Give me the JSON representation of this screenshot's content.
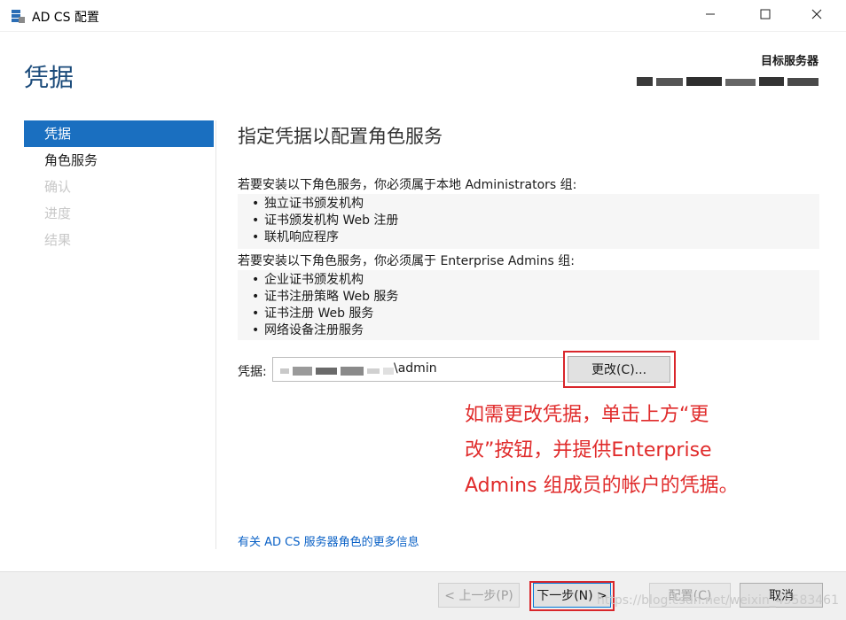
{
  "window": {
    "title": "AD CS 配置",
    "icon": "server-icon"
  },
  "header": {
    "page_title": "凭据",
    "target_label": "目标服务器"
  },
  "sidebar": {
    "items": [
      {
        "label": "凭据",
        "state": "active"
      },
      {
        "label": "角色服务",
        "state": "enabled"
      },
      {
        "label": "确认",
        "state": "disabled"
      },
      {
        "label": "进度",
        "state": "disabled"
      },
      {
        "label": "结果",
        "state": "disabled"
      }
    ]
  },
  "main": {
    "heading": "指定凭据以配置角色服务",
    "section1": {
      "intro": "若要安装以下角色服务，你必须属于本地 Administrators 组:",
      "items": [
        "独立证书颁发机构",
        "证书颁发机构 Web 注册",
        "联机响应程序"
      ]
    },
    "section2": {
      "intro": "若要安装以下角色服务，你必须属于 Enterprise Admins 组:",
      "items": [
        "企业证书颁发机构",
        "证书注册策略 Web 服务",
        "证书注册 Web 服务",
        "网络设备注册服务"
      ]
    },
    "credentials_label": "凭据:",
    "credentials_value": "\\admin",
    "change_button": "更改(C)...",
    "annotation": "如需更改凭据，单击上方“更改”按钮，并提供Enterprise Admins 组成员的帐户的凭据。",
    "more_info_link": "有关 AD CS 服务器角色的更多信息"
  },
  "footer": {
    "prev_label": "< 上一步(P)",
    "next_label": "下一步(N) >",
    "configure_label": "配置(C)",
    "cancel_label": "取消"
  },
  "watermark": "https://blog.csdn.net/weixin_45583461",
  "colors": {
    "accent": "#1a6fc0",
    "title_blue": "#1a4a7a",
    "annotation_red": "#e02b2b",
    "link": "#0a61c6"
  }
}
